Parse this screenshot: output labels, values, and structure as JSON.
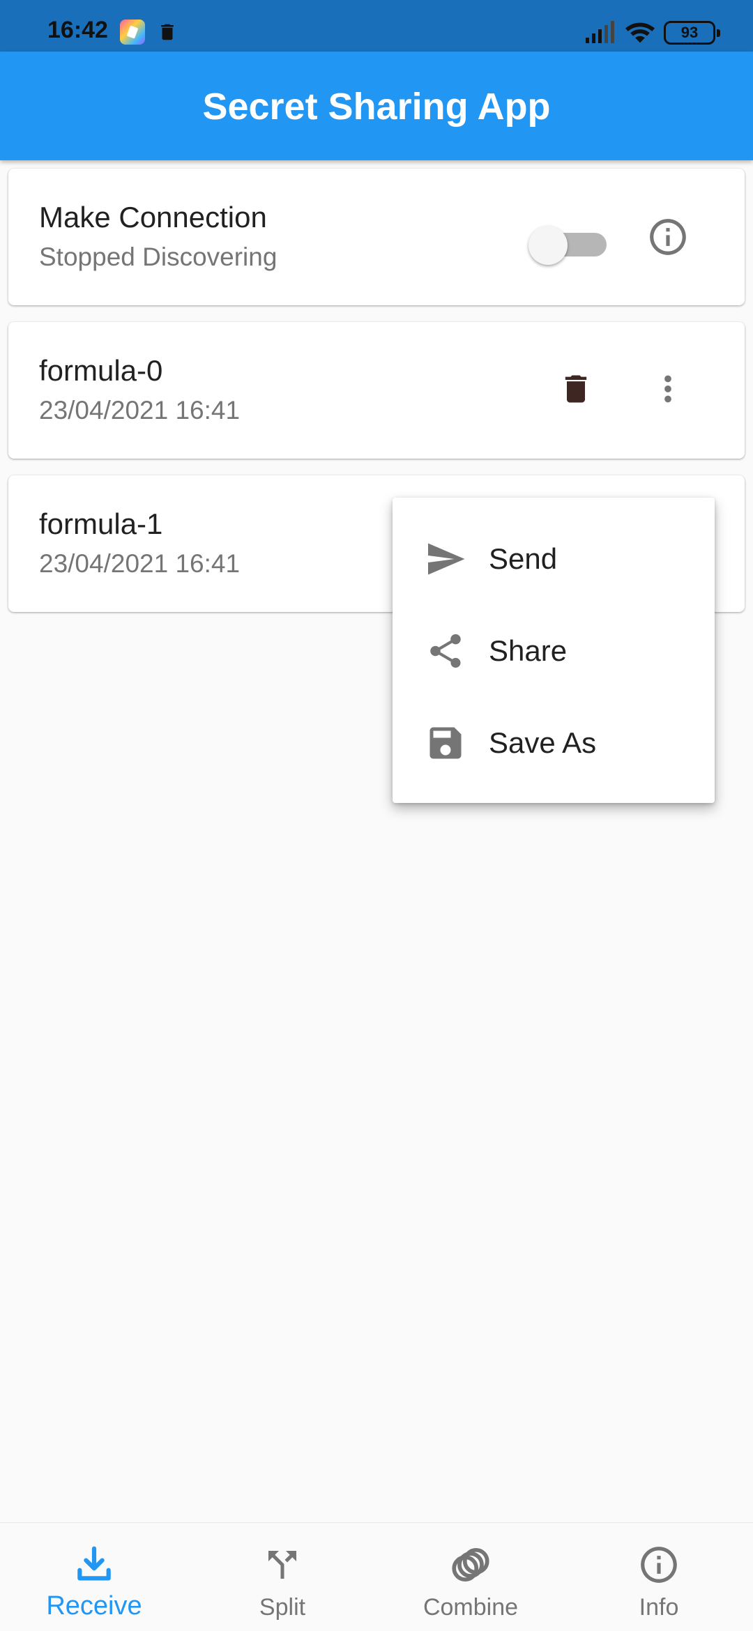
{
  "status_bar": {
    "time": "16:42",
    "battery": "93"
  },
  "app_bar": {
    "title": "Secret Sharing App"
  },
  "connection": {
    "title": "Make Connection",
    "status": "Stopped Discovering",
    "toggle_on": false
  },
  "items": [
    {
      "name": "formula-0",
      "date": "23/04/2021 16:41"
    },
    {
      "name": "formula-1",
      "date": "23/04/2021 16:41"
    }
  ],
  "menu": {
    "items": [
      {
        "label": "Send",
        "icon": "send-icon"
      },
      {
        "label": "Share",
        "icon": "share-icon"
      },
      {
        "label": "Save As",
        "icon": "save-icon"
      }
    ]
  },
  "bottom_nav": {
    "items": [
      {
        "label": "Receive",
        "icon": "download-icon",
        "active": true
      },
      {
        "label": "Split",
        "icon": "split-icon",
        "active": false
      },
      {
        "label": "Combine",
        "icon": "combine-icon",
        "active": false
      },
      {
        "label": "Info",
        "icon": "info-icon",
        "active": false
      }
    ]
  },
  "colors": {
    "primary": "#2196f3",
    "status_bar": "#1a6fbb",
    "trash": "#3e2723",
    "icon_grey": "#757575"
  }
}
